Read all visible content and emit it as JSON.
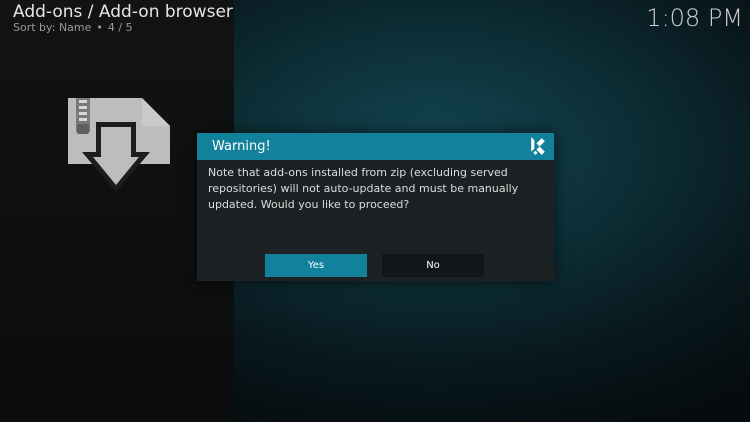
{
  "header": {
    "title": "Add-ons / Add-on browser",
    "sort_label": "Sort by: Name",
    "separator": "•",
    "position": "4 / 5"
  },
  "clock": {
    "time": "1:08 PM"
  },
  "addon_icon": {
    "icon": "zip-install-icon"
  },
  "dialog": {
    "title": "Warning!",
    "logo": "kodi-logo-icon",
    "message": "Note that add-ons installed from zip (excluding served repositories) will not auto-update and must be manually updated. Would you like to proceed?",
    "buttons": {
      "yes_label": "Yes",
      "no_label": "No"
    },
    "focused_button": "Yes"
  },
  "colors": {
    "accent": "#12819b",
    "dialog_bg": "#1c2224",
    "icon_gray": "#bdbdbd"
  }
}
